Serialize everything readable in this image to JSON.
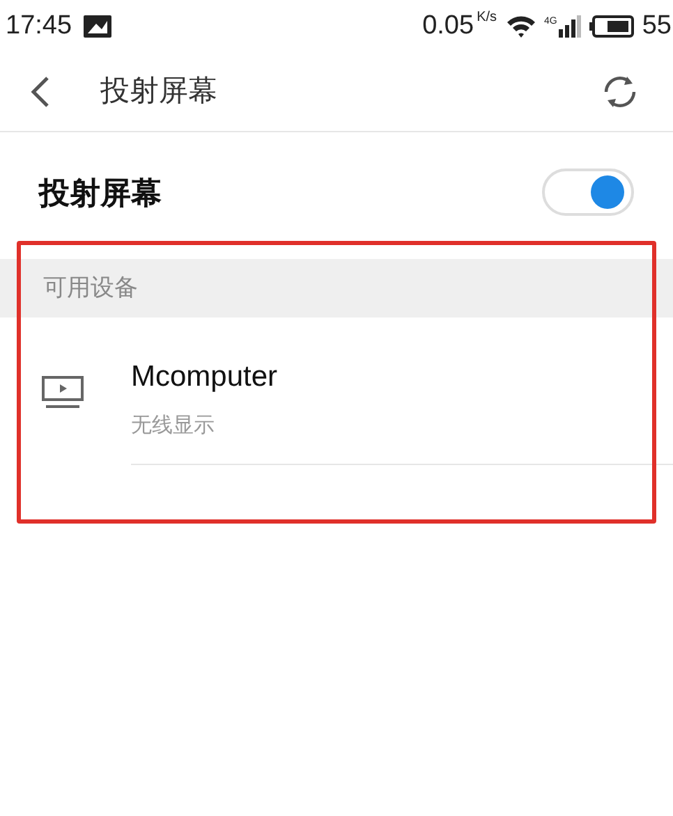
{
  "status_bar": {
    "time": "17:45",
    "speed": "0.05",
    "speed_unit": "K/s",
    "network": "4G",
    "battery": "55"
  },
  "header": {
    "title": "投射屏幕"
  },
  "cast_toggle": {
    "label": "投射屏幕",
    "on": true
  },
  "section": {
    "title": "可用设备"
  },
  "devices": [
    {
      "name": "Mcomputer",
      "status": "无线显示"
    }
  ],
  "annotation": {
    "kind": "highlight-box",
    "color": "#e0302a"
  }
}
